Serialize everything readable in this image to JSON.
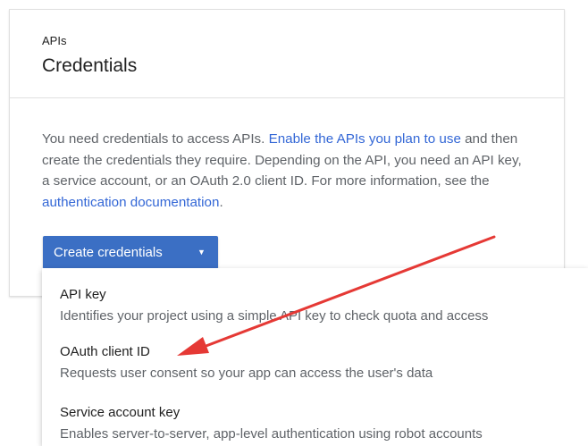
{
  "header": {
    "breadcrumb": "APIs",
    "title": "Credentials"
  },
  "intro": {
    "text_1": "You need credentials to access APIs. ",
    "link_enable": "Enable the APIs you plan to use",
    "text_2": " and then create the credentials they require. Depending on the API, you need an API key, a service account, or an OAuth 2.0 client ID. For more information, see the ",
    "link_auth": "authentication documentation",
    "text_3": "."
  },
  "create_button": {
    "label": "Create credentials",
    "icon": "caret-down-icon",
    "color": "#3b6fc4"
  },
  "menu": {
    "items": [
      {
        "title": "API key",
        "description": "Identifies your project using a simple API key to check quota and access"
      },
      {
        "title": "OAuth client ID",
        "description": "Requests user consent so your app can access the user's data"
      },
      {
        "title": "Service account key",
        "description": "Enables server-to-server, app-level authentication using robot accounts"
      }
    ]
  },
  "annotation": {
    "arrow_color": "#e53935",
    "points_to": "OAuth client ID"
  },
  "colors": {
    "link": "#3367d6",
    "body_text": "#5f6368",
    "heading_text": "#212121"
  }
}
